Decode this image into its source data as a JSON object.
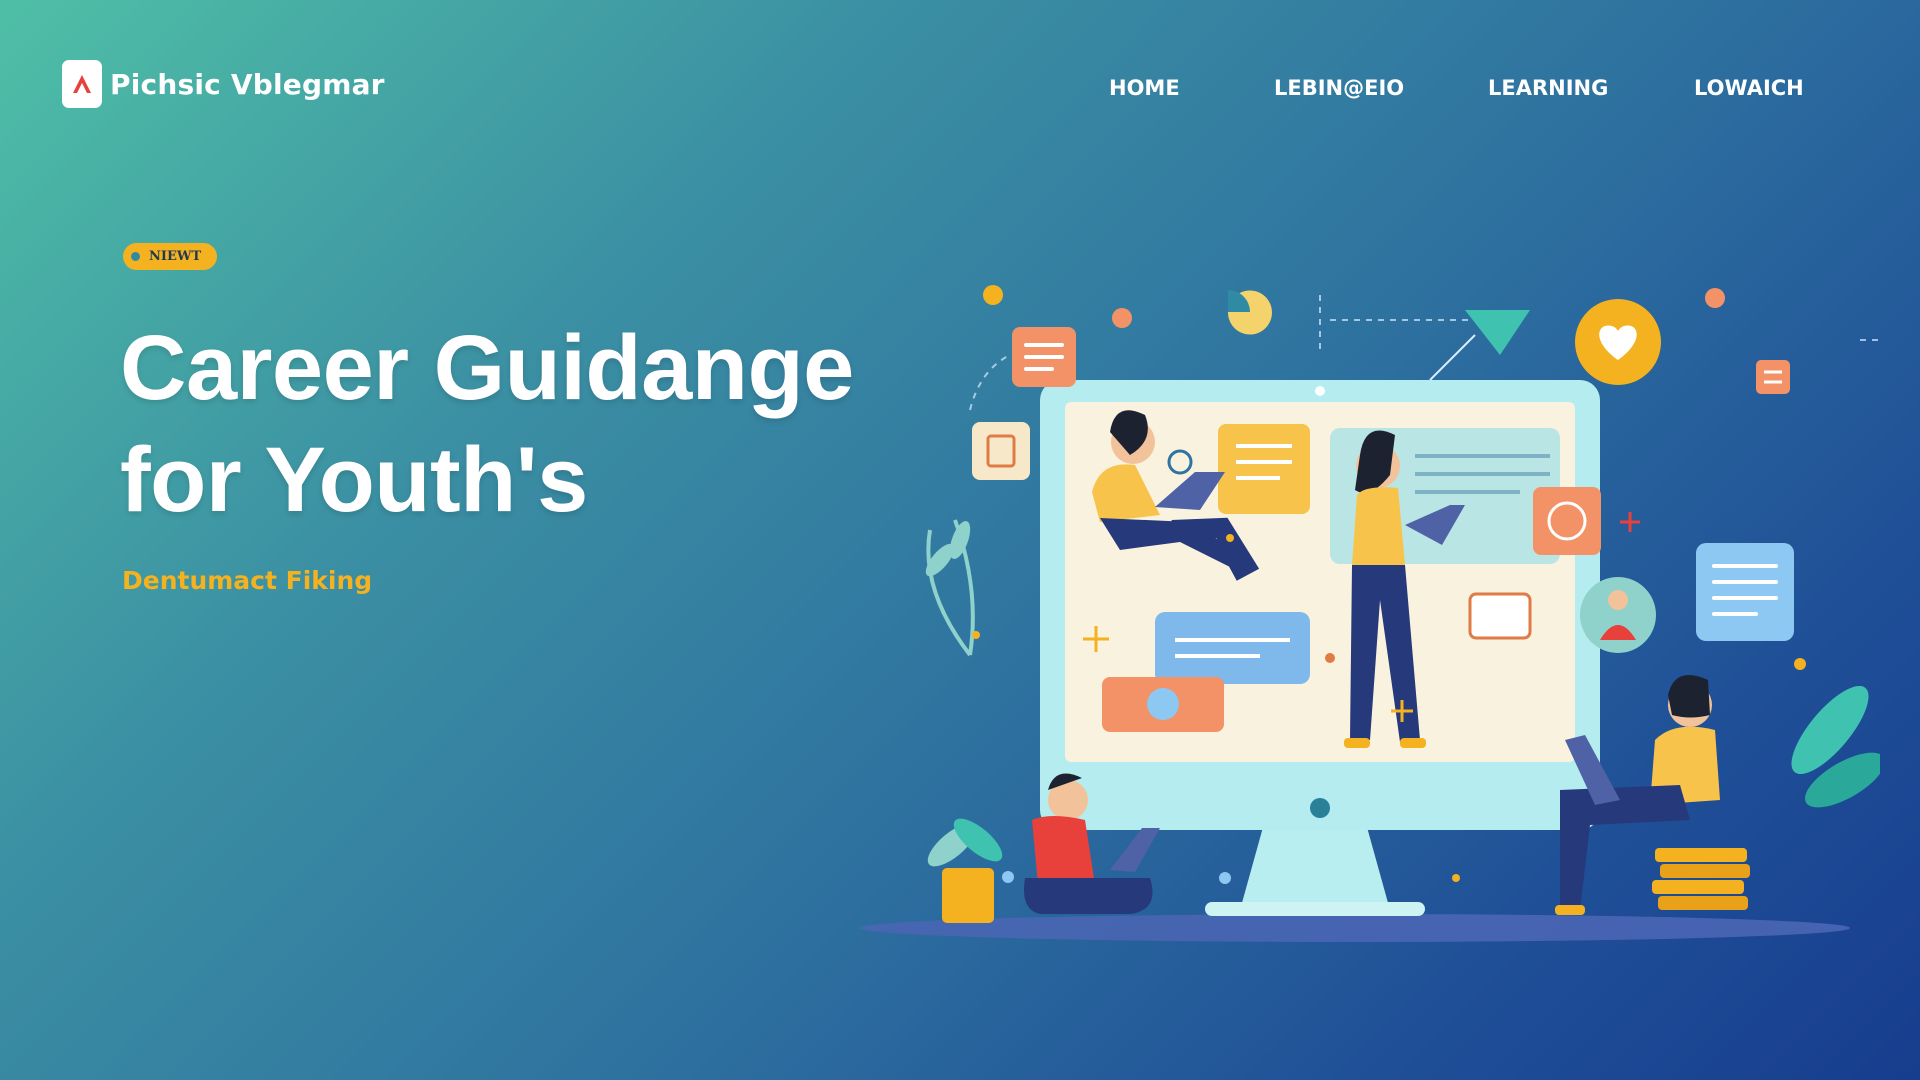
{
  "brand": {
    "name": "Pichsic Vblegmar",
    "logo_icon": "a-logo-icon"
  },
  "nav": {
    "items": [
      {
        "label": "HOME"
      },
      {
        "label": "LEBIN@EIO"
      },
      {
        "label": "LEARNING"
      },
      {
        "label": "LOWAICH"
      }
    ]
  },
  "hero": {
    "badge": "NIEWT",
    "title_line1": "Career Guidange",
    "title_line2": "for Youth's",
    "subtitle": "Dentumact Fiking"
  },
  "colors": {
    "accent_yellow": "#f4b120",
    "accent_orange": "#f08a5d",
    "accent_teal": "#3fc2b0",
    "bg_start": "#4fbfa6",
    "bg_end": "#173d8e"
  }
}
